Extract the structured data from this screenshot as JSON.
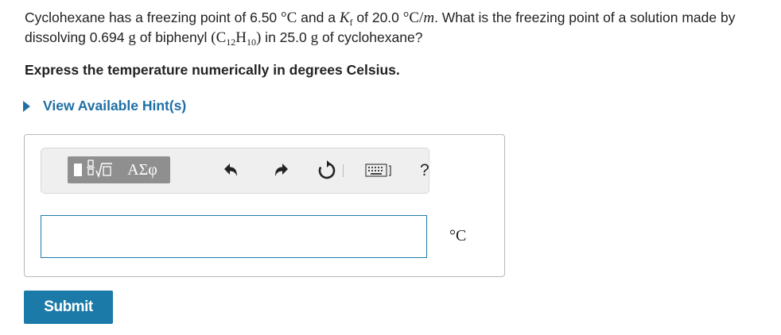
{
  "question": {
    "p1": "Cyclohexane has a freezing point of 6.50 ",
    "deg1": "°C",
    "p2": " and a ",
    "kf_symbol": "K",
    "kf_sub": "f",
    "p3": " of 20.0 ",
    "unit2": "°C/",
    "unit2_m": "m",
    "p4": ". What is the freezing point of a solution made by dissolving 0.694 ",
    "g1": "g",
    "p5": " of biphenyl ",
    "formula_open": "(C",
    "c_sub": "12",
    "formula_h": "H",
    "h_sub": "10",
    "formula_close": ")",
    "p6": " in 25.0 ",
    "g2": "g",
    "p7": " of cyclohexane?"
  },
  "instruction": "Express the temperature numerically in degrees Celsius.",
  "hint_label": "View Available Hint(s)",
  "toolbar": {
    "greek_label": "ΑΣφ",
    "help_label": "?"
  },
  "answer": {
    "value": "",
    "unit": "°C"
  },
  "submit_label": "Submit",
  "colors": {
    "accent": "#1b7aa7",
    "link": "#1f6fa5",
    "toolbar_button": "#8f8f8f"
  }
}
